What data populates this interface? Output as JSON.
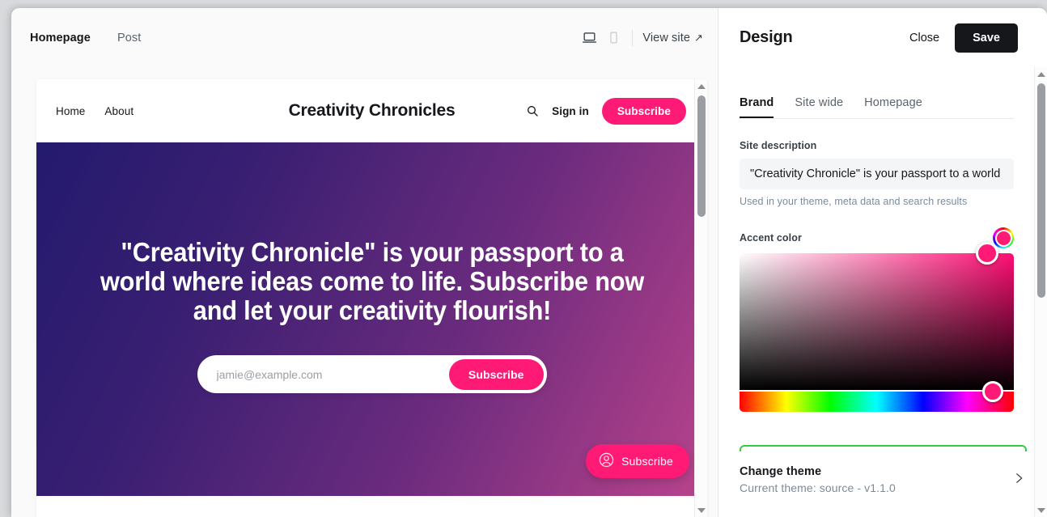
{
  "app": {
    "topbar": {
      "tabs": [
        {
          "label": "Homepage",
          "active": true
        },
        {
          "label": "Post",
          "active": false
        }
      ],
      "desktop_icon": "laptop-icon",
      "mobile_icon": "mobile-icon",
      "view_site_label": "View site",
      "view_site_arrow": "↗"
    }
  },
  "preview": {
    "site": {
      "nav": [
        {
          "label": "Home"
        },
        {
          "label": "About"
        }
      ],
      "title": "Creativity Chronicles",
      "search_icon": "search-icon",
      "signin_label": "Sign in",
      "subscribe_label": "Subscribe"
    },
    "hero": {
      "headline": "\"Creativity Chronicle\" is your passport to a world where ideas come to life. Subscribe now and let your creativity flourish!",
      "email_placeholder": "jamie@example.com",
      "email_value": "",
      "subscribe_label": "Subscribe"
    },
    "portal": {
      "label": "Subscribe",
      "icon": "user-circle-icon"
    }
  },
  "design_panel": {
    "title": "Design",
    "close_label": "Close",
    "save_label": "Save",
    "tabs": [
      {
        "label": "Brand",
        "active": true
      },
      {
        "label": "Site wide",
        "active": false
      },
      {
        "label": "Homepage",
        "active": false
      }
    ],
    "site_description": {
      "label": "Site description",
      "value": "\"Creativity Chronicle\" is your passport to a world where ideas come to life.",
      "placeholder": "Site description",
      "hint": "Used in your theme, meta data and search results"
    },
    "accent_color": {
      "label": "Accent color",
      "value": "#FF1A75",
      "swatch_icon": "color-wheel-icon"
    },
    "theme": {
      "title": "Change theme",
      "subtitle": "Current theme: source - v1.1.0",
      "chevron_icon": "chevron-right-icon"
    }
  },
  "colors": {
    "accent": "#FF1A75",
    "save_button": "#15171A",
    "hero_gradient_start": "#231A6E",
    "hero_gradient_end": "#B8448C",
    "highlight_outline": "#30CF43"
  }
}
